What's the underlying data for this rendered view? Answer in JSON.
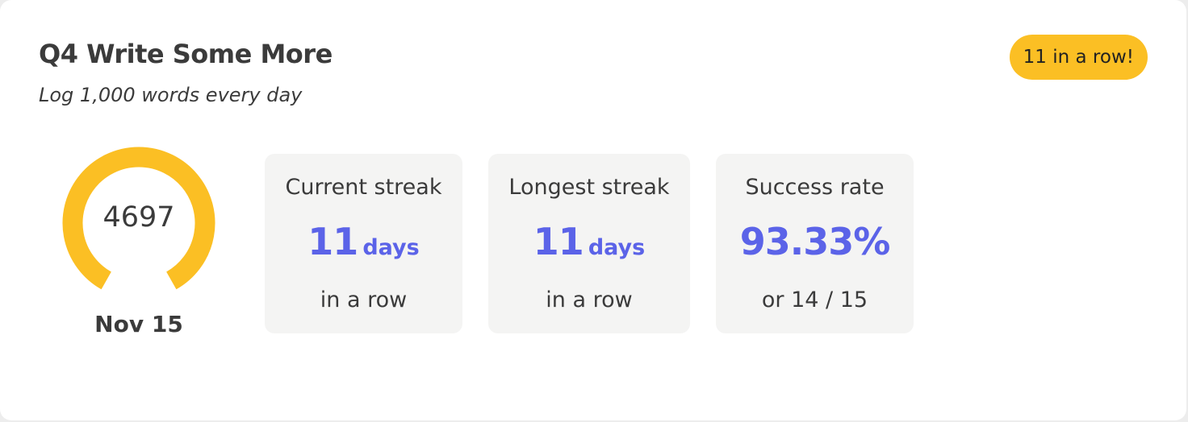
{
  "goal": {
    "title": "Q4 Write Some More",
    "subtitle": "Log 1,000 words every day",
    "streak_badge": "11 in a row!"
  },
  "gauge": {
    "value": "4697",
    "date": "Nov 15",
    "color": "#fbbf24"
  },
  "stats": {
    "current_streak": {
      "label": "Current streak",
      "value": "11",
      "unit": "days",
      "footer": "in a row"
    },
    "longest_streak": {
      "label": "Longest streak",
      "value": "11",
      "unit": "days",
      "footer": "in a row"
    },
    "success_rate": {
      "label": "Success rate",
      "value": "93.33%",
      "footer": "or 14 / 15"
    }
  },
  "colors": {
    "accent": "#5b63e8",
    "badge": "#fbbf24",
    "text": "#3b3b3b",
    "tile": "#f4f4f3"
  }
}
